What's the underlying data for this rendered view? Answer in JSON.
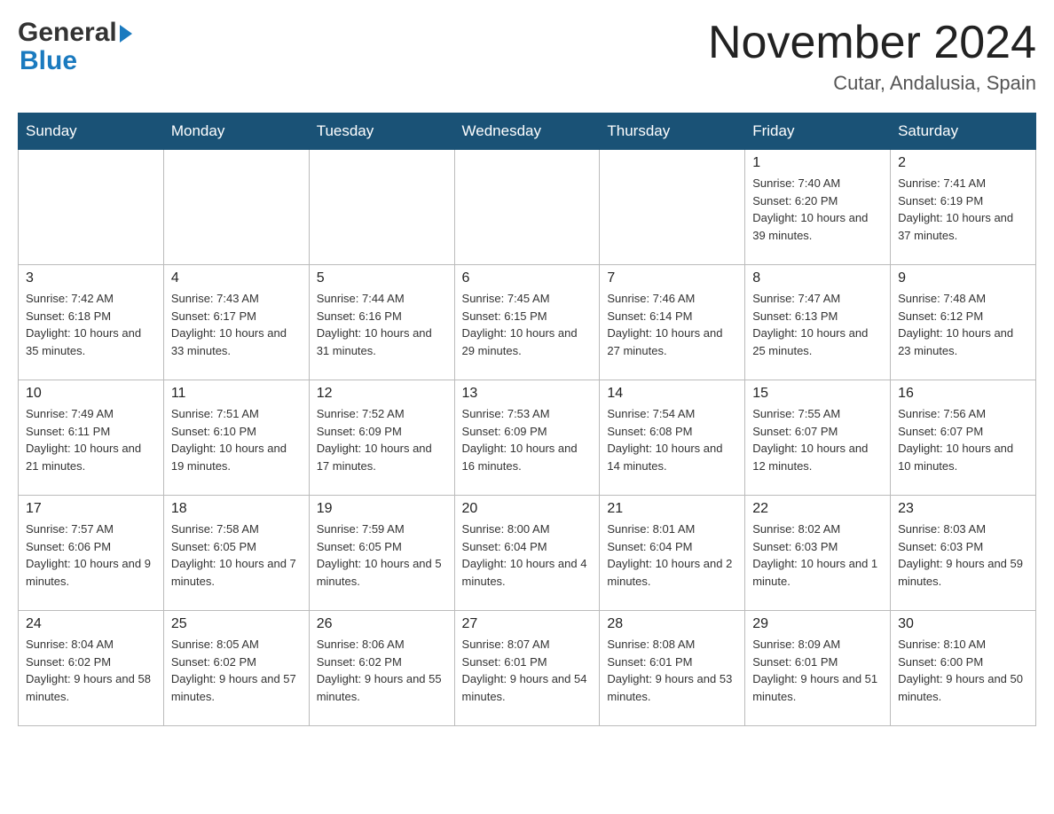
{
  "header": {
    "logo_general": "General",
    "logo_blue": "Blue",
    "month_title": "November 2024",
    "location": "Cutar, Andalusia, Spain"
  },
  "days_of_week": [
    "Sunday",
    "Monday",
    "Tuesday",
    "Wednesday",
    "Thursday",
    "Friday",
    "Saturday"
  ],
  "weeks": [
    [
      {
        "day": "",
        "info": ""
      },
      {
        "day": "",
        "info": ""
      },
      {
        "day": "",
        "info": ""
      },
      {
        "day": "",
        "info": ""
      },
      {
        "day": "",
        "info": ""
      },
      {
        "day": "1",
        "info": "Sunrise: 7:40 AM\nSunset: 6:20 PM\nDaylight: 10 hours and 39 minutes."
      },
      {
        "day": "2",
        "info": "Sunrise: 7:41 AM\nSunset: 6:19 PM\nDaylight: 10 hours and 37 minutes."
      }
    ],
    [
      {
        "day": "3",
        "info": "Sunrise: 7:42 AM\nSunset: 6:18 PM\nDaylight: 10 hours and 35 minutes."
      },
      {
        "day": "4",
        "info": "Sunrise: 7:43 AM\nSunset: 6:17 PM\nDaylight: 10 hours and 33 minutes."
      },
      {
        "day": "5",
        "info": "Sunrise: 7:44 AM\nSunset: 6:16 PM\nDaylight: 10 hours and 31 minutes."
      },
      {
        "day": "6",
        "info": "Sunrise: 7:45 AM\nSunset: 6:15 PM\nDaylight: 10 hours and 29 minutes."
      },
      {
        "day": "7",
        "info": "Sunrise: 7:46 AM\nSunset: 6:14 PM\nDaylight: 10 hours and 27 minutes."
      },
      {
        "day": "8",
        "info": "Sunrise: 7:47 AM\nSunset: 6:13 PM\nDaylight: 10 hours and 25 minutes."
      },
      {
        "day": "9",
        "info": "Sunrise: 7:48 AM\nSunset: 6:12 PM\nDaylight: 10 hours and 23 minutes."
      }
    ],
    [
      {
        "day": "10",
        "info": "Sunrise: 7:49 AM\nSunset: 6:11 PM\nDaylight: 10 hours and 21 minutes."
      },
      {
        "day": "11",
        "info": "Sunrise: 7:51 AM\nSunset: 6:10 PM\nDaylight: 10 hours and 19 minutes."
      },
      {
        "day": "12",
        "info": "Sunrise: 7:52 AM\nSunset: 6:09 PM\nDaylight: 10 hours and 17 minutes."
      },
      {
        "day": "13",
        "info": "Sunrise: 7:53 AM\nSunset: 6:09 PM\nDaylight: 10 hours and 16 minutes."
      },
      {
        "day": "14",
        "info": "Sunrise: 7:54 AM\nSunset: 6:08 PM\nDaylight: 10 hours and 14 minutes."
      },
      {
        "day": "15",
        "info": "Sunrise: 7:55 AM\nSunset: 6:07 PM\nDaylight: 10 hours and 12 minutes."
      },
      {
        "day": "16",
        "info": "Sunrise: 7:56 AM\nSunset: 6:07 PM\nDaylight: 10 hours and 10 minutes."
      }
    ],
    [
      {
        "day": "17",
        "info": "Sunrise: 7:57 AM\nSunset: 6:06 PM\nDaylight: 10 hours and 9 minutes."
      },
      {
        "day": "18",
        "info": "Sunrise: 7:58 AM\nSunset: 6:05 PM\nDaylight: 10 hours and 7 minutes."
      },
      {
        "day": "19",
        "info": "Sunrise: 7:59 AM\nSunset: 6:05 PM\nDaylight: 10 hours and 5 minutes."
      },
      {
        "day": "20",
        "info": "Sunrise: 8:00 AM\nSunset: 6:04 PM\nDaylight: 10 hours and 4 minutes."
      },
      {
        "day": "21",
        "info": "Sunrise: 8:01 AM\nSunset: 6:04 PM\nDaylight: 10 hours and 2 minutes."
      },
      {
        "day": "22",
        "info": "Sunrise: 8:02 AM\nSunset: 6:03 PM\nDaylight: 10 hours and 1 minute."
      },
      {
        "day": "23",
        "info": "Sunrise: 8:03 AM\nSunset: 6:03 PM\nDaylight: 9 hours and 59 minutes."
      }
    ],
    [
      {
        "day": "24",
        "info": "Sunrise: 8:04 AM\nSunset: 6:02 PM\nDaylight: 9 hours and 58 minutes."
      },
      {
        "day": "25",
        "info": "Sunrise: 8:05 AM\nSunset: 6:02 PM\nDaylight: 9 hours and 57 minutes."
      },
      {
        "day": "26",
        "info": "Sunrise: 8:06 AM\nSunset: 6:02 PM\nDaylight: 9 hours and 55 minutes."
      },
      {
        "day": "27",
        "info": "Sunrise: 8:07 AM\nSunset: 6:01 PM\nDaylight: 9 hours and 54 minutes."
      },
      {
        "day": "28",
        "info": "Sunrise: 8:08 AM\nSunset: 6:01 PM\nDaylight: 9 hours and 53 minutes."
      },
      {
        "day": "29",
        "info": "Sunrise: 8:09 AM\nSunset: 6:01 PM\nDaylight: 9 hours and 51 minutes."
      },
      {
        "day": "30",
        "info": "Sunrise: 8:10 AM\nSunset: 6:00 PM\nDaylight: 9 hours and 50 minutes."
      }
    ]
  ]
}
